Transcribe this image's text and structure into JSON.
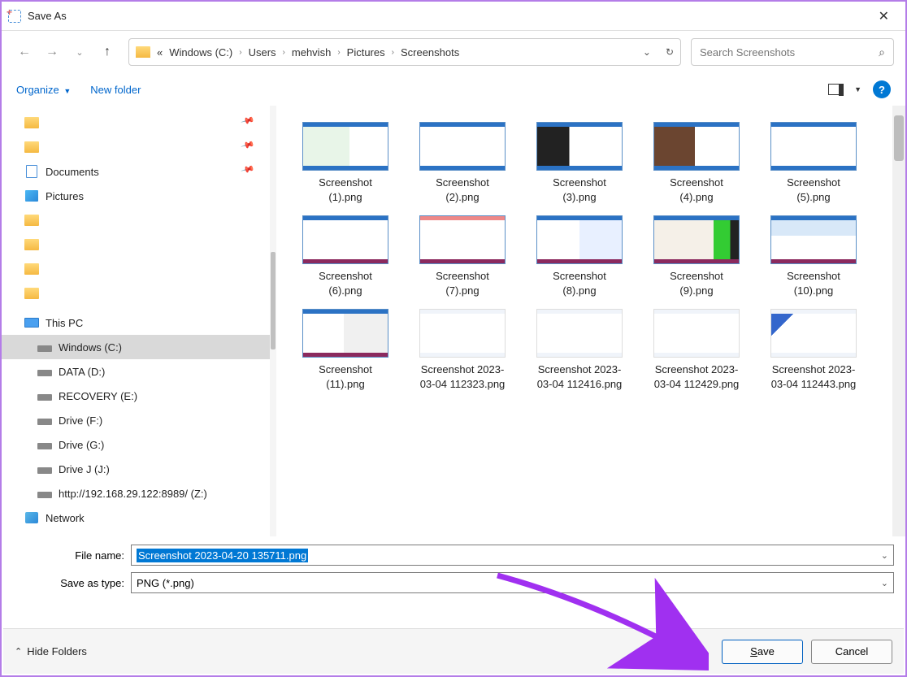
{
  "window": {
    "title": "Save As"
  },
  "breadcrumbs": {
    "prefix": "«",
    "items": [
      "Windows (C:)",
      "Users",
      "mehvish",
      "Pictures",
      "Screenshots"
    ]
  },
  "search": {
    "placeholder": "Search Screenshots"
  },
  "toolbar": {
    "organize": "Organize",
    "new_folder": "New folder"
  },
  "tree": {
    "documents": "Documents",
    "pictures": "Pictures",
    "this_pc": "This PC",
    "drives": [
      "Windows (C:)",
      "DATA (D:)",
      "RECOVERY (E:)",
      "Drive (F:)",
      "Drive (G:)",
      "Drive J (J:)",
      "http://192.168.29.122:8989/ (Z:)"
    ],
    "network": "Network"
  },
  "files": [
    "Screenshot (1).png",
    "Screenshot (2).png",
    "Screenshot (3).png",
    "Screenshot (4).png",
    "Screenshot (5).png",
    "Screenshot (6).png",
    "Screenshot (7).png",
    "Screenshot (8).png",
    "Screenshot (9).png",
    "Screenshot (10).png",
    "Screenshot (11).png",
    "Screenshot 2023-03-04 112323.png",
    "Screenshot 2023-03-04 112416.png",
    "Screenshot 2023-03-04 112429.png",
    "Screenshot 2023-03-04 112443.png"
  ],
  "form": {
    "filename_label": "File name:",
    "filename_value": "Screenshot 2023-04-20 135711.png",
    "type_label": "Save as type:",
    "type_value": "PNG (*.png)"
  },
  "buttons": {
    "hide_folders": "Hide Folders",
    "save": "Save",
    "cancel": "Cancel"
  }
}
